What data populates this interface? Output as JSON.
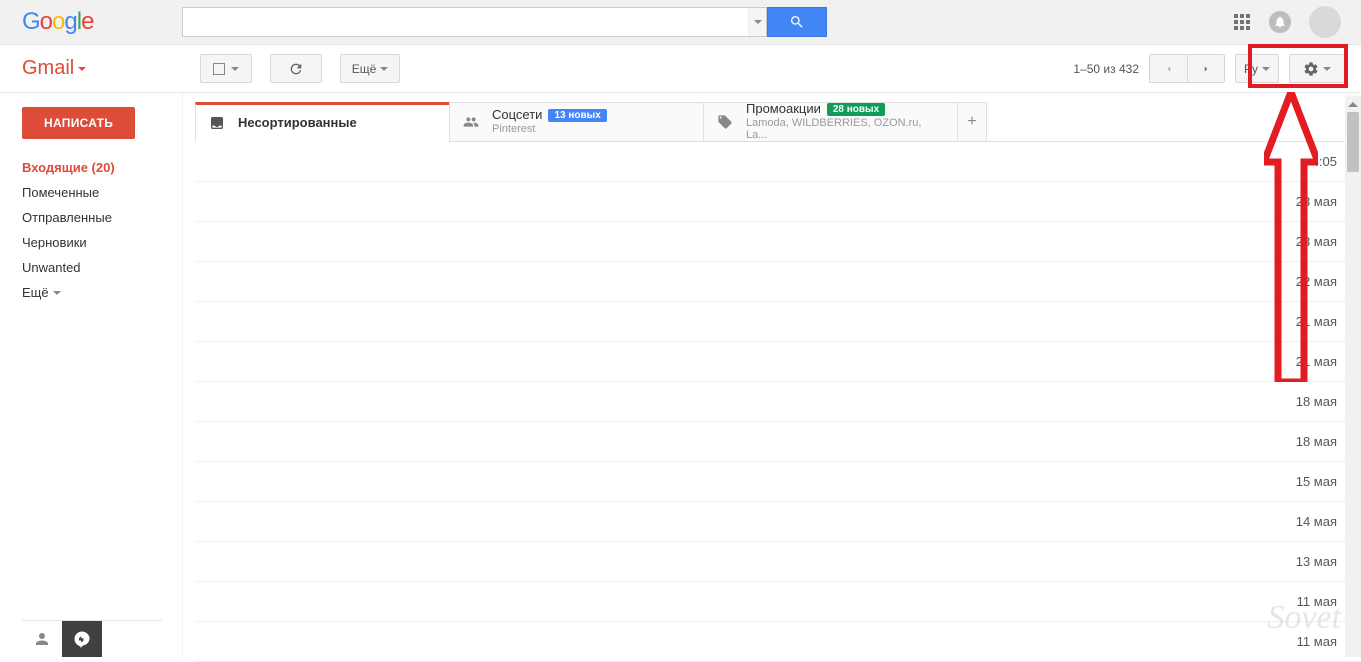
{
  "header": {
    "logo": "Google",
    "search_placeholder": ""
  },
  "brand": "Gmail",
  "toolbar": {
    "more_label": "Ещё",
    "pagination": "1–50 из 432",
    "lang": "Ру"
  },
  "sidebar": {
    "compose": "НАПИСАТЬ",
    "items": [
      {
        "label": "Входящие (20)",
        "active": true
      },
      {
        "label": "Помеченные"
      },
      {
        "label": "Отправленные"
      },
      {
        "label": "Черновики"
      },
      {
        "label": "Unwanted"
      }
    ],
    "more": "Ещё"
  },
  "tabs": [
    {
      "title": "Несортированные",
      "icon": "inbox",
      "active": true
    },
    {
      "title": "Соцсети",
      "icon": "people",
      "badge": "13 новых",
      "badge_color": "blue",
      "sub": "Pinterest"
    },
    {
      "title": "Промоакции",
      "icon": "tag",
      "badge": "28 новых",
      "badge_color": "green",
      "sub": "Lamoda, WILDBERRIES, OZON.ru, La..."
    }
  ],
  "emails": [
    {
      "date": "4:05"
    },
    {
      "date": "23 мая"
    },
    {
      "date": "23 мая"
    },
    {
      "date": "22 мая"
    },
    {
      "date": "21 мая"
    },
    {
      "date": "21 мая"
    },
    {
      "date": "18 мая"
    },
    {
      "date": "18 мая"
    },
    {
      "date": "15 мая"
    },
    {
      "date": "14 мая"
    },
    {
      "date": "13 мая"
    },
    {
      "date": "11 мая"
    },
    {
      "date": "11 мая"
    }
  ],
  "watermark": "Sovet"
}
